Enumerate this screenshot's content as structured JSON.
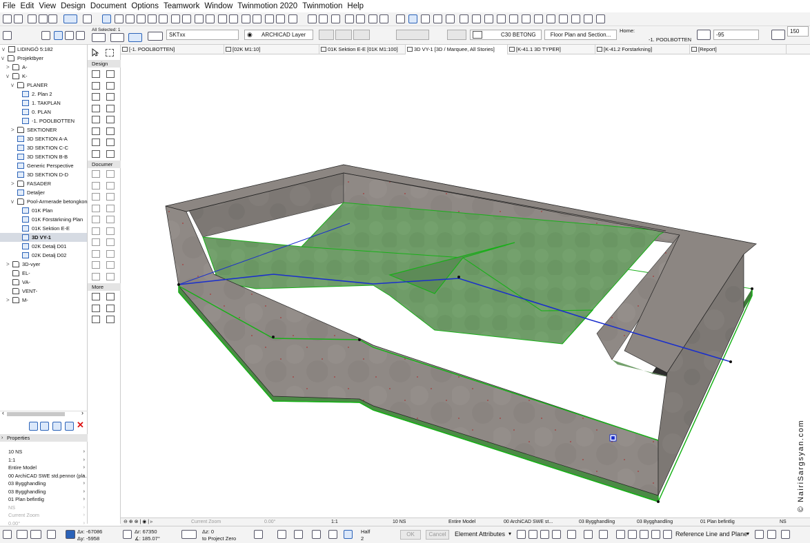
{
  "menu": [
    "File",
    "Edit",
    "View",
    "Design",
    "Document",
    "Options",
    "Teamwork",
    "Window",
    "Twinmotion 2020",
    "Twinmotion",
    "Help"
  ],
  "infobox": {
    "all_selected": "All Selected: 1",
    "element_id": "SKTxx",
    "layer": "ARCHICAD Layer",
    "building_material": "C30 BETONG",
    "floor_plan_section": "Floor Plan and Section...",
    "home_label": "Home:",
    "home_story": "-1. POOLBOTTEN",
    "offset": "-95",
    "thickness": "150"
  },
  "navigator": {
    "root": "LIDINGÖ 5:182",
    "items": [
      {
        "label": "Projektbyer",
        "indent": 1,
        "tw": "v",
        "icon": "fold"
      },
      {
        "label": "A-",
        "indent": 2,
        "tw": ">",
        "icon": "fold"
      },
      {
        "label": "K-",
        "indent": 2,
        "tw": "v",
        "icon": "fold"
      },
      {
        "label": "PLANER",
        "indent": 3,
        "tw": "v",
        "icon": "fold"
      },
      {
        "label": "2. Plan 2",
        "indent": 4,
        "tw": "",
        "icon": "vw"
      },
      {
        "label": "1. TAKPLAN",
        "indent": 4,
        "tw": "",
        "icon": "vw"
      },
      {
        "label": "0. PLAN",
        "indent": 4,
        "tw": "",
        "icon": "vw"
      },
      {
        "label": "-1. POOLBOTTEN",
        "indent": 4,
        "tw": "",
        "icon": "vw"
      },
      {
        "label": "SEKTIONER",
        "indent": 3,
        "tw": ">",
        "icon": "fold"
      },
      {
        "label": "3D SEKTION A-A",
        "indent": 3,
        "tw": "",
        "icon": "vw"
      },
      {
        "label": "3D SEKTION C-C",
        "indent": 3,
        "tw": "",
        "icon": "vw"
      },
      {
        "label": "3D SEKTION B-B",
        "indent": 3,
        "tw": "",
        "icon": "vw"
      },
      {
        "label": "Generic Perspective",
        "indent": 3,
        "tw": "",
        "icon": "vw"
      },
      {
        "label": "3D SEKTION D-D",
        "indent": 3,
        "tw": "",
        "icon": "vw"
      },
      {
        "label": "FASADER",
        "indent": 3,
        "tw": ">",
        "icon": "fold"
      },
      {
        "label": "Detaljer",
        "indent": 3,
        "tw": "",
        "icon": "vw"
      },
      {
        "label": "Pool-Armerade betongkons",
        "indent": 3,
        "tw": "v",
        "icon": "fold"
      },
      {
        "label": "01K Plan",
        "indent": 4,
        "tw": "",
        "icon": "vw"
      },
      {
        "label": "01K Förstärkning Plan",
        "indent": 4,
        "tw": "",
        "icon": "vw"
      },
      {
        "label": "01K Sektion E-E",
        "indent": 4,
        "tw": "",
        "icon": "vw"
      },
      {
        "label": "3D VY-1",
        "indent": 4,
        "tw": "",
        "icon": "vw",
        "selected": true
      },
      {
        "label": "02K Detalj D01",
        "indent": 4,
        "tw": "",
        "icon": "vw"
      },
      {
        "label": "02K Detalj D02",
        "indent": 4,
        "tw": "",
        "icon": "vw"
      },
      {
        "label": "3D-vyer",
        "indent": 2,
        "tw": ">",
        "icon": "fold"
      },
      {
        "label": "EL-",
        "indent": 2,
        "tw": "",
        "icon": "fold"
      },
      {
        "label": "VA-",
        "indent": 2,
        "tw": "",
        "icon": "fold"
      },
      {
        "label": "VENT-",
        "indent": 2,
        "tw": "",
        "icon": "fold"
      },
      {
        "label": "M-",
        "indent": 2,
        "tw": ">",
        "icon": "fold"
      }
    ]
  },
  "properties": {
    "title": "Properties",
    "rows": [
      {
        "label": "10 NS",
        "dim": false
      },
      {
        "label": "1:1",
        "dim": false
      },
      {
        "label": "Entire Model",
        "dim": false
      },
      {
        "label": "00 ArchiCAD SWE std.pennor (pla...",
        "dim": false
      },
      {
        "label": "03 Bygghandling",
        "dim": false
      },
      {
        "label": "03 Bygghandling",
        "dim": false
      },
      {
        "label": "01 Plan befintlig",
        "dim": false
      },
      {
        "label": "NS",
        "dim": true
      },
      {
        "label": "Current Zoom",
        "dim": true
      },
      {
        "label": "0.00°",
        "dim": true
      }
    ]
  },
  "toolbox": {
    "design": "Design",
    "document": "Documer",
    "more": "More"
  },
  "tabs": [
    {
      "label": "[-1. POOLBOTTEN]",
      "active": false
    },
    {
      "label": "[02K M1:10]",
      "active": false
    },
    {
      "label": "01K Sektion E-E [01K M1:100]",
      "active": false
    },
    {
      "label": "3D VY-1 [3D / Marquee, All Stories]",
      "active": true
    },
    {
      "label": "[K-41.1 3D TYPER]",
      "active": false
    },
    {
      "label": "[K-41.2 Forstarkning]",
      "active": false
    },
    {
      "label": "[Report]",
      "active": false
    }
  ],
  "statusbar": {
    "zoom": "Current Zoom",
    "angle": "0.00°",
    "scale": "1:1",
    "pen": "10 NS",
    "model": "Entire Model",
    "pen_set": "00 ArchiCAD SWE st...",
    "layer_combo": "03 Bygghandling",
    "dim_std": "03 Bygghandling",
    "renovation": "01 Plan befintlig",
    "mvo": "NS"
  },
  "coords": {
    "ax": "Δx: -67086",
    "ay": "Δy: -5958",
    "ar": "Δr: 67350",
    "aa": "∡: 185.07°",
    "az": "Δz: 0",
    "to_zero": "to Project Zero",
    "half": "Half",
    "half_n": "2"
  },
  "bottom": {
    "ok": "OK",
    "cancel": "Cancel",
    "element_attributes": "Element Attributes",
    "reference": "Reference Line and Plane"
  },
  "watermark": "© NairiSargsyan.com",
  "colors": {
    "wall": "#8f8985",
    "slab": "#6c9d66",
    "edge": "#14a814",
    "ref": "#1a2fcc"
  }
}
